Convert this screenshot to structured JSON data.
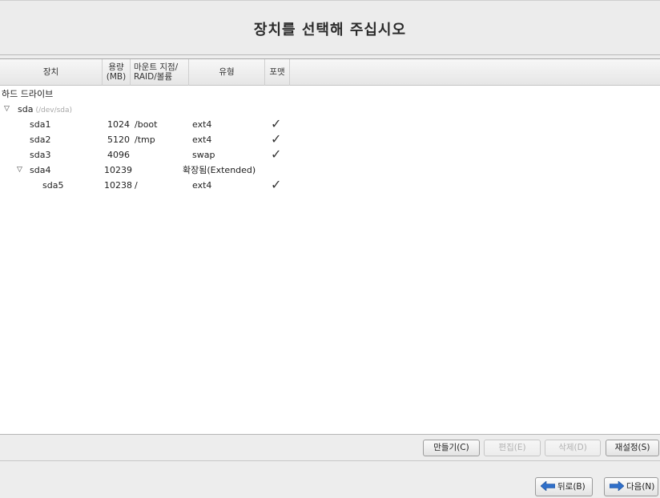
{
  "header": {
    "title": "장치를 선택해 주십시오"
  },
  "columns": {
    "device": "장치",
    "size_line1": "용량",
    "size_line2": "(MB)",
    "mount_line1": "마운트 지점/",
    "mount_line2": "RAID/볼륨",
    "type": "유형",
    "format": "포맷"
  },
  "tree": {
    "group_label": "하드 드라이브",
    "disk": {
      "name": "sda",
      "path": "(/dev/sda)"
    },
    "rows": [
      {
        "device": "sda1",
        "size": "1024",
        "mount": "/boot",
        "type": "ext4",
        "format": true
      },
      {
        "device": "sda2",
        "size": "5120",
        "mount": "/tmp",
        "type": "ext4",
        "format": true
      },
      {
        "device": "sda3",
        "size": "4096",
        "mount": "",
        "type": "swap",
        "format": true
      },
      {
        "device": "sda4",
        "size": "10239",
        "mount": "",
        "type": "확장됨(Extended)",
        "format": false
      },
      {
        "device": "sda5",
        "size": "10238",
        "mount": "/",
        "type": "ext4",
        "format": true
      }
    ],
    "check_glyph": "✓",
    "expander_glyph": "▽"
  },
  "toolbar": {
    "create": "만들기(C)",
    "edit": "편집(E)",
    "delete": "삭제(D)",
    "reset": "재설정(S)"
  },
  "nav": {
    "back": "뒤로(B)",
    "next": "다음(N)"
  },
  "colors": {
    "arrow_blue": "#2f6fc9"
  }
}
